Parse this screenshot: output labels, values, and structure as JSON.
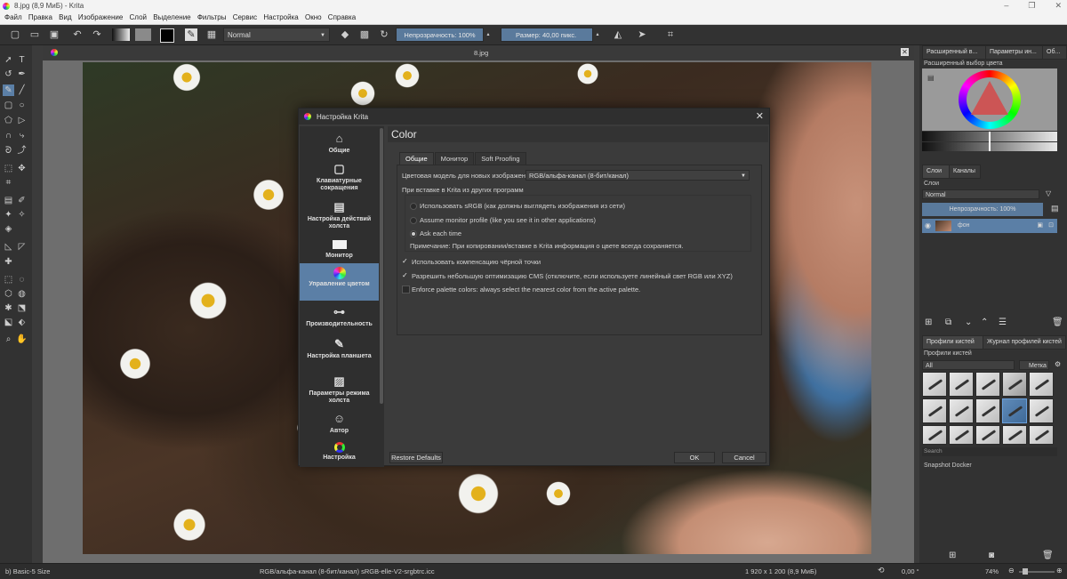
{
  "window": {
    "title": "8.jpg (8,9 МиБ)  - Krita",
    "controls": [
      "–",
      "❐",
      "✕"
    ]
  },
  "menu": [
    "Файл",
    "Правка",
    "Вид",
    "Изображение",
    "Слой",
    "Выделение",
    "Фильтры",
    "Сервис",
    "Настройка",
    "Окно",
    "Справка"
  ],
  "toolbar": {
    "blend_mode": "Normal",
    "opacity": "Непрозрачность: 100%",
    "size": "Размер: 40,00 пикс."
  },
  "document": {
    "tab_title": "8.jpg"
  },
  "dialog": {
    "title": "Настройка Krita",
    "nav": [
      {
        "label": "Общие",
        "icon": "home-icon"
      },
      {
        "label": "Клавиатурные сокращения",
        "icon": "keyboard-icon"
      },
      {
        "label": "Настройка действий холста",
        "icon": "canvas-input-icon"
      },
      {
        "label": "Монитор",
        "icon": "monitor-icon"
      },
      {
        "label": "Управление цветом",
        "icon": "color-management-icon"
      },
      {
        "label": "Производительность",
        "icon": "performance-icon"
      },
      {
        "label": "Настройка планшета",
        "icon": "tablet-pen-icon"
      },
      {
        "label": "Параметры режима холста",
        "icon": "canvas-mode-icon"
      },
      {
        "label": "Автор",
        "icon": "author-icon"
      },
      {
        "label": "Настройка",
        "icon": "color-selector-icon"
      }
    ],
    "selected_nav": "Управление цветом",
    "page_title": "Color",
    "tabs": [
      "Общие",
      "Монитор",
      "Soft Proofing"
    ],
    "active_tab": "Общие",
    "color_model_label": "Цветовая модель для новых изображений:",
    "color_model_value": "RGB/альфа-канал (8-бит/канал)",
    "paste_label": "При вставке в Krita из других программ",
    "paste_options": [
      {
        "label": "Использовать sRGB (как должны выглядеть изображения из сети)",
        "selected": false
      },
      {
        "label": "Assume monitor profile (like you see it in other applications)",
        "selected": false
      },
      {
        "label": "Ask each time",
        "selected": true
      }
    ],
    "paste_note": "Примечание: При копировании/вставке в Krita информация о цвете всегда сохраняется.",
    "checkboxes": [
      {
        "label": "Использовать компенсацию чёрной точки",
        "checked": true
      },
      {
        "label": "Разрешить небольшую оптимизацию CMS (отключите, если используете линейный свет RGB или XYZ)",
        "checked": true
      },
      {
        "label": "Enforce palette colors: always select the nearest color from the active palette.",
        "checked": false
      }
    ],
    "buttons": {
      "restore": "Restore Defaults",
      "ok": "OK",
      "cancel": "Cancel"
    }
  },
  "right_dock": {
    "top_tabs": [
      "Расширенный в...",
      "Параметры ин...",
      "Об..."
    ],
    "color_selector_title": "Расширенный выбор цвета",
    "layer_tabs": [
      "Слои",
      "Каналы"
    ],
    "layers_title": "Слои",
    "layer_blend": "Normal",
    "layer_opacity": "Непрозрачность: 100%",
    "layer_name": "фон",
    "brush_tabs": [
      "Профили кистей",
      "Журнал профилей кистей"
    ],
    "brush_title": "Профили кистей",
    "brush_filter": "All",
    "brush_tag": "Метка",
    "search_label": "Search",
    "snapshot_title": "Snapshot Docker"
  },
  "status": {
    "brush": "b) Basic-5 Size",
    "color_space": "RGB/альфа-канал (8-бит/канал)  sRGB-elle-V2-srgbtrc.icc",
    "dimensions": "1 920 x 1 200 (8,9 МиБ)",
    "rotation": "0,00 °",
    "zoom": "74%"
  },
  "colors": {
    "accent": "#5b7fa6",
    "panel_bg": "#323232",
    "dialog_bg": "#3b3b3b"
  }
}
